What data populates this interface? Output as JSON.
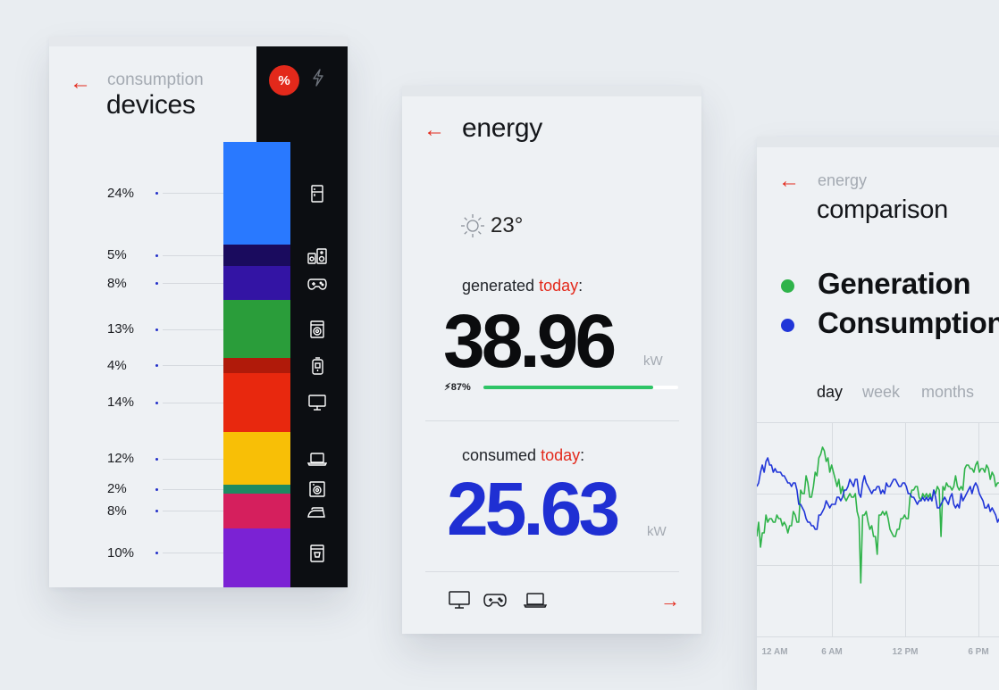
{
  "devices_card": {
    "subtitle": "consumption",
    "title": "devices",
    "percent_toggle": "%",
    "breakdown": [
      {
        "percent": "24%",
        "color": "#2979ff",
        "icon": "fridge-icon"
      },
      {
        "percent": "5%",
        "color": "#1a0b5e",
        "icon": "speakers-icon"
      },
      {
        "percent": "8%",
        "color": "#3314a4",
        "icon": "gamepad-icon"
      },
      {
        "percent": "13%",
        "color": "#2a9d3a",
        "icon": "washing-machine-icon"
      },
      {
        "percent": "4%",
        "color": "#b01a0a",
        "icon": "kettle-icon"
      },
      {
        "percent": "14%",
        "color": "#e8280e",
        "icon": "monitor-icon"
      },
      {
        "percent": "12%",
        "color": "#f8bf06",
        "icon": "laptop-icon"
      },
      {
        "percent": "2%",
        "color": "#1e8a62",
        "icon": "oven-icon"
      },
      {
        "percent": "8%",
        "color": "#d51f5d",
        "icon": "iron-icon"
      },
      {
        "percent": "10%",
        "color": "#7b22d4",
        "icon": "coffee-machine-icon"
      }
    ]
  },
  "energy_card": {
    "title": "energy",
    "weather": {
      "temperature": "23°",
      "icon": "sun-icon"
    },
    "generated": {
      "label_prefix": "generated ",
      "label_highlight": "today",
      "label_suffix": ":",
      "value": "38.96",
      "unit": "kW",
      "battery_label": "87%",
      "battery_fraction": 0.87
    },
    "consumed": {
      "label_prefix": "consumed ",
      "label_highlight": "today",
      "label_suffix": ":",
      "value": "25.63",
      "unit": "kW"
    },
    "footer_icons": [
      "monitor-icon",
      "gamepad-icon",
      "laptop-icon"
    ]
  },
  "comparison_card": {
    "subtitle": "energy",
    "title": "comparison",
    "legend": [
      {
        "label": "Generation",
        "color": "#2fb34a"
      },
      {
        "label": "Consumption",
        "color": "#2136d8"
      }
    ],
    "ranges": {
      "day": "day",
      "week": "week",
      "months": "months",
      "selected": "day"
    },
    "chart_data": {
      "type": "line",
      "x_labels": [
        "12 AM",
        "6 AM",
        "12 PM",
        "6 PM"
      ],
      "series": [
        {
          "name": "Generation",
          "color": "#2fb34a",
          "values": [
            56,
            64,
            50,
            58,
            58,
            68,
            64,
            66,
            66,
            64,
            64,
            68,
            66,
            66,
            62,
            64,
            62,
            58,
            62,
            62,
            70,
            68,
            64,
            64,
            82,
            80,
            80,
            90,
            86,
            78,
            78,
            84,
            92,
            90,
            100,
            102,
            106,
            104,
            98,
            100,
            92,
            96,
            92,
            88,
            84,
            88,
            80,
            84,
            78,
            76,
            78,
            80,
            78,
            78,
            80,
            70,
            66,
            30,
            68,
            68,
            70,
            64,
            60,
            62,
            56,
            56,
            46,
            68,
            68,
            70,
            68,
            70,
            66,
            60,
            58,
            56,
            56,
            60,
            60,
            66,
            66,
            68,
            66,
            66,
            78,
            82,
            82,
            84,
            84,
            78,
            76,
            80,
            78,
            80,
            78,
            80,
            76,
            82,
            80,
            84,
            82,
            56,
            84,
            82,
            86,
            84,
            84,
            82,
            84,
            90,
            84,
            82,
            84,
            82,
            94,
            96,
            96,
            94,
            94,
            92,
            96,
            98,
            92,
            94,
            94,
            92,
            96,
            94,
            88,
            92,
            90,
            84,
            86,
            86,
            84,
            86,
            84,
            82,
            80,
            82,
            82,
            84,
            82,
            80,
            80,
            78,
            80,
            80
          ]
        },
        {
          "name": "Consumption",
          "color": "#2136d8",
          "values": [
            84,
            86,
            92,
            96,
            92,
            98,
            100,
            96,
            96,
            92,
            94,
            92,
            92,
            92,
            90,
            90,
            88,
            86,
            86,
            84,
            86,
            86,
            82,
            74,
            74,
            72,
            70,
            66,
            64,
            64,
            62,
            62,
            60,
            60,
            68,
            68,
            70,
            72,
            76,
            74,
            72,
            74,
            74,
            74,
            78,
            78,
            76,
            78,
            82,
            82,
            84,
            88,
            86,
            84,
            88,
            88,
            80,
            78,
            86,
            90,
            86,
            84,
            82,
            80,
            82,
            82,
            84,
            84,
            80,
            82,
            80,
            86,
            84,
            84,
            86,
            88,
            88,
            86,
            84,
            84,
            86,
            86,
            84,
            80,
            80,
            78,
            78,
            76,
            74,
            76,
            76,
            78,
            76,
            78,
            76,
            78,
            76,
            82,
            78,
            72,
            72,
            74,
            76,
            78,
            76,
            74,
            78,
            80,
            74,
            72,
            74,
            72,
            80,
            76,
            78,
            80,
            82,
            84,
            80,
            84,
            86,
            84,
            80,
            78,
            76,
            72,
            72,
            74,
            70,
            72,
            70,
            68,
            64,
            66,
            62,
            62,
            64,
            62,
            60,
            60,
            62,
            62,
            64,
            64,
            60,
            62,
            64,
            66
          ]
        }
      ]
    }
  }
}
